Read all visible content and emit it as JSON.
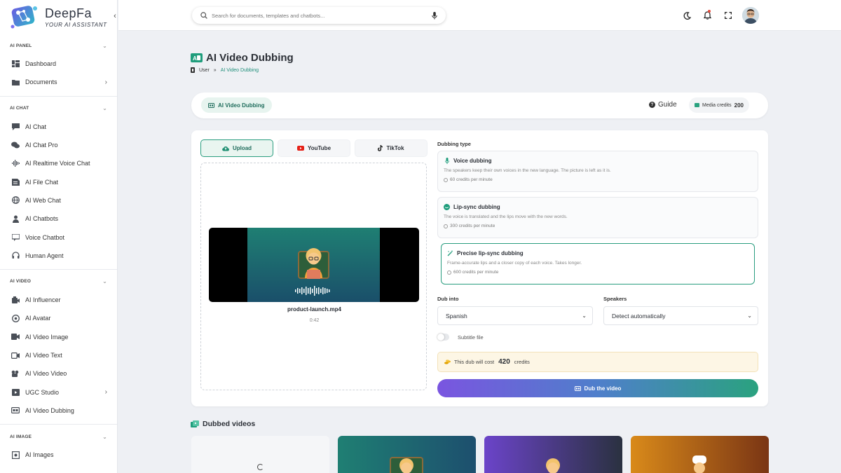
{
  "brand": {
    "name": "DeepFa",
    "tagline": "YOUR AI ASSISTANT"
  },
  "sidebar": {
    "sections": [
      {
        "title": "AI PANEL",
        "items": [
          {
            "label": "Dashboard",
            "icon": "dashboard-icon",
            "has_arrow": false
          },
          {
            "label": "Documents",
            "icon": "folder-icon",
            "has_arrow": true
          }
        ]
      },
      {
        "title": "AI CHAT",
        "items": [
          {
            "label": "AI Chat",
            "icon": "chat-icon",
            "has_arrow": false
          },
          {
            "label": "AI Chat Pro",
            "icon": "chat-pro-icon",
            "has_arrow": false
          },
          {
            "label": "AI Realtime Voice Chat",
            "icon": "waveform-icon",
            "has_arrow": false
          },
          {
            "label": "AI File Chat",
            "icon": "file-chat-icon",
            "has_arrow": false
          },
          {
            "label": "AI Web Chat",
            "icon": "globe-icon",
            "has_arrow": false
          },
          {
            "label": "AI Chatbots",
            "icon": "chatbot-icon",
            "has_arrow": false
          },
          {
            "label": "Voice Chatbot",
            "icon": "voice-chatbot-icon",
            "has_arrow": false
          },
          {
            "label": "Human Agent",
            "icon": "headset-icon",
            "has_arrow": false
          }
        ]
      },
      {
        "title": "AI VIDEO",
        "items": [
          {
            "label": "AI Influencer",
            "icon": "influencer-icon",
            "has_arrow": false
          },
          {
            "label": "AI Avatar",
            "icon": "avatar-icon",
            "has_arrow": false
          },
          {
            "label": "AI Video Image",
            "icon": "video-image-icon",
            "has_arrow": false
          },
          {
            "label": "AI Video Text",
            "icon": "video-text-icon",
            "has_arrow": false
          },
          {
            "label": "AI Video Video",
            "icon": "video-video-icon",
            "has_arrow": false
          },
          {
            "label": "UGC Studio",
            "icon": "ugc-icon",
            "has_arrow": true
          },
          {
            "label": "AI Video Dubbing",
            "icon": "dubbing-icon",
            "has_arrow": false
          }
        ]
      },
      {
        "title": "AI IMAGE",
        "items": [
          {
            "label": "AI Images",
            "icon": "images-icon",
            "has_arrow": false
          }
        ]
      }
    ]
  },
  "search": {
    "placeholder": "Search for documents, templates and chatbots..."
  },
  "topbar": {
    "icons": [
      "moon-icon",
      "bell-icon",
      "fullscreen-icon",
      "globe-icon"
    ]
  },
  "page": {
    "title": "AI Video Dubbing",
    "breadcrumb": {
      "root": "User",
      "separator": "»",
      "current": "AI Video Dubbing"
    }
  },
  "tabbar": {
    "active_tab": "AI Video Dubbing",
    "guide_label": "Guide",
    "credits_label": "Media credits",
    "credits_value": "200"
  },
  "source_tabs": [
    {
      "label": "Upload",
      "icon": "cloud-upload-icon",
      "active": true
    },
    {
      "label": "YouTube",
      "icon": "youtube-icon",
      "active": false
    },
    {
      "label": "TikTok",
      "icon": "tiktok-icon",
      "active": false
    }
  ],
  "upload": {
    "file_name": "product-launch.mp4",
    "duration": "0:42"
  },
  "dubbing": {
    "label": "Dubbing type",
    "options": [
      {
        "title": "Voice dubbing",
        "desc": "The speakers keep their own voices in the new language. The picture is left as it is.",
        "cost": "60 credits per minute",
        "icon": "microphone-icon",
        "selected": false
      },
      {
        "title": "Lip-sync dubbing",
        "desc": "The voice is translated and the lips move with the new words.",
        "cost": "300 credits per minute",
        "icon": "lipsync-icon",
        "selected": false
      },
      {
        "title": "Precise lip-sync dubbing",
        "desc": "Frame-accurate lips and a closer copy of each voice. Takes longer.",
        "cost": "600 credits per minute",
        "icon": "magic-wand-icon",
        "selected": true
      }
    ]
  },
  "dub_into": {
    "label": "Dub into",
    "value": "Spanish"
  },
  "speakers": {
    "label": "Speakers",
    "value": "Detect automatically"
  },
  "subtitle": {
    "label": "Subtitle file",
    "on": false
  },
  "cost": {
    "prefix": "This dub will cost",
    "value": "420",
    "suffix": "credits"
  },
  "dub_button": {
    "label": "Dub the video"
  },
  "dubbed": {
    "title": "Dubbed videos"
  },
  "colors": {
    "accent": "#2a9d7f",
    "button_start": "#7a55e0",
    "button_end": "#2aa27f",
    "cost_bg": "#fdf6e5"
  }
}
